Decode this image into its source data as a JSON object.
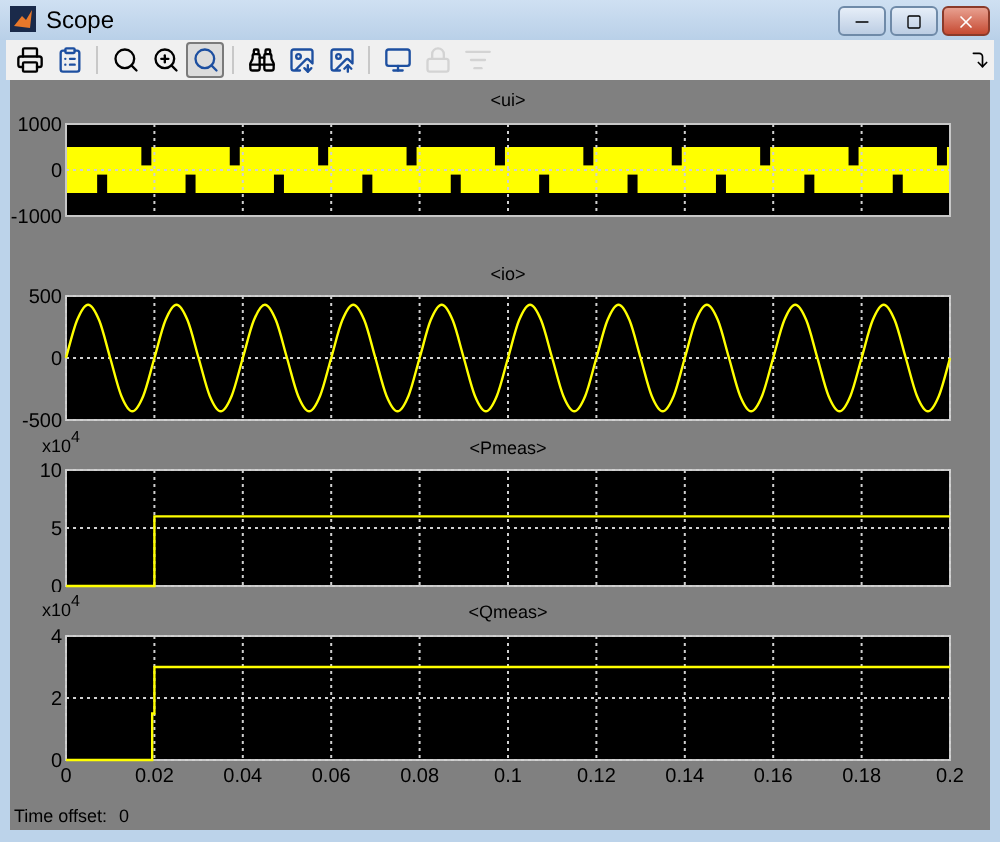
{
  "window": {
    "title": "Scope"
  },
  "toolbar": [
    {
      "kind": "print",
      "selected": false,
      "disabled": false
    },
    {
      "kind": "parameters",
      "selected": false,
      "disabled": false
    },
    {
      "kind": "zoom",
      "selected": false,
      "disabled": false
    },
    {
      "kind": "zoom-x",
      "selected": false,
      "disabled": false
    },
    {
      "kind": "zoom-y",
      "selected": true,
      "disabled": false
    },
    {
      "kind": "autoscale",
      "selected": false,
      "disabled": false
    },
    {
      "kind": "save-axes",
      "selected": false,
      "disabled": false
    },
    {
      "kind": "restore-axes",
      "selected": false,
      "disabled": false
    },
    {
      "kind": "floating",
      "selected": false,
      "disabled": false
    },
    {
      "kind": "lock",
      "selected": false,
      "disabled": true
    },
    {
      "kind": "signals",
      "selected": false,
      "disabled": true
    }
  ],
  "panels": [
    {
      "kind": "waveform",
      "title": "<ui>",
      "y_tick_labels": [
        "1000",
        "0",
        "-1000"
      ]
    },
    {
      "kind": "chart",
      "chart_data": {
        "type": "line",
        "title": "<io>",
        "xlim": [
          0,
          0.2
        ],
        "ylim": [
          -500,
          500
        ],
        "grid": true,
        "yticks": [
          -500,
          0,
          500
        ],
        "x": [
          0,
          0.0025,
          0.005,
          0.0075,
          0.01,
          0.0125,
          0.015,
          0.0175,
          0.02,
          0.0225,
          0.025,
          0.0275,
          0.03,
          0.0325,
          0.035,
          0.0375,
          0.04,
          0.0425,
          0.045,
          0.0475,
          0.05,
          0.0525,
          0.055,
          0.0575,
          0.06,
          0.0625,
          0.065,
          0.0675,
          0.07,
          0.0725,
          0.075,
          0.0775,
          0.08,
          0.0825,
          0.085,
          0.0875,
          0.09,
          0.0925,
          0.095,
          0.0975,
          0.1,
          0.1025,
          0.105,
          0.1075,
          0.11,
          0.1125,
          0.115,
          0.1175,
          0.12,
          0.1225,
          0.125,
          0.1275,
          0.13,
          0.1325,
          0.135,
          0.1375,
          0.14,
          0.1425,
          0.145,
          0.1475,
          0.15,
          0.1525,
          0.155,
          0.1575,
          0.16,
          0.1625,
          0.165,
          0.1675,
          0.17,
          0.1725,
          0.175,
          0.1775,
          0.18,
          0.1825,
          0.185,
          0.1875,
          0.19,
          0.1925,
          0.195,
          0.1975,
          0.2
        ],
        "series": [
          {
            "values": [
              0,
              304,
              430,
              304,
              0,
              -304,
              -430,
              -304,
              0,
              304,
              430,
              304,
              0,
              -304,
              -430,
              -304,
              0,
              304,
              430,
              304,
              0,
              -304,
              -430,
              -304,
              0,
              304,
              430,
              304,
              0,
              -304,
              -430,
              -304,
              0,
              304,
              430,
              304,
              0,
              -304,
              -430,
              -304,
              0,
              304,
              430,
              304,
              0,
              -304,
              -430,
              -304,
              0,
              304,
              430,
              304,
              0,
              -304,
              -430,
              -304,
              0,
              304,
              430,
              304,
              0,
              -304,
              -430,
              -304,
              0,
              304,
              430,
              304,
              0,
              -304,
              -430,
              -304,
              0,
              304,
              430,
              304,
              0,
              -304,
              -430,
              -304,
              0
            ]
          }
        ]
      }
    },
    {
      "kind": "chart",
      "multiplier": {
        "base": "x10",
        "exponent": "4"
      },
      "chart_data": {
        "type": "line",
        "title": "<Pmeas>",
        "xlim": [
          0,
          0.2
        ],
        "ylim": [
          0,
          10
        ],
        "grid": true,
        "yticks": [
          0,
          5,
          10
        ],
        "x": [
          0,
          0.02,
          0.02,
          0.2
        ],
        "series": [
          {
            "values": [
              0,
              0,
              6,
              6
            ]
          }
        ]
      }
    },
    {
      "kind": "chart",
      "multiplier": {
        "base": "x10",
        "exponent": "4"
      },
      "chart_data": {
        "type": "line",
        "title": "<Qmeas>",
        "xlim": [
          0,
          0.2
        ],
        "ylim": [
          0,
          4
        ],
        "grid": true,
        "xticks": [
          {
            "value": 0,
            "label": "0"
          },
          {
            "value": 0.02,
            "label": "0.02"
          },
          {
            "value": 0.04,
            "label": "0.04"
          },
          {
            "value": 0.06,
            "label": "0.06"
          },
          {
            "value": 0.08,
            "label": "0.08"
          },
          {
            "value": 0.1,
            "label": "0.1"
          },
          {
            "value": 0.12,
            "label": "0.12"
          },
          {
            "value": 0.14,
            "label": "0.14"
          },
          {
            "value": 0.16,
            "label": "0.16"
          },
          {
            "value": 0.18,
            "label": "0.18"
          },
          {
            "value": 0.2,
            "label": "0.2"
          }
        ],
        "yticks": [
          0,
          2,
          4
        ],
        "x": [
          0,
          0.0195,
          0.0195,
          0.02,
          0.02,
          0.2
        ],
        "series": [
          {
            "values": [
              0,
              0,
              1.5,
              1.5,
              3,
              3
            ]
          }
        ]
      }
    }
  ],
  "status_bar": {
    "label": "Time offset:",
    "value": "0"
  }
}
